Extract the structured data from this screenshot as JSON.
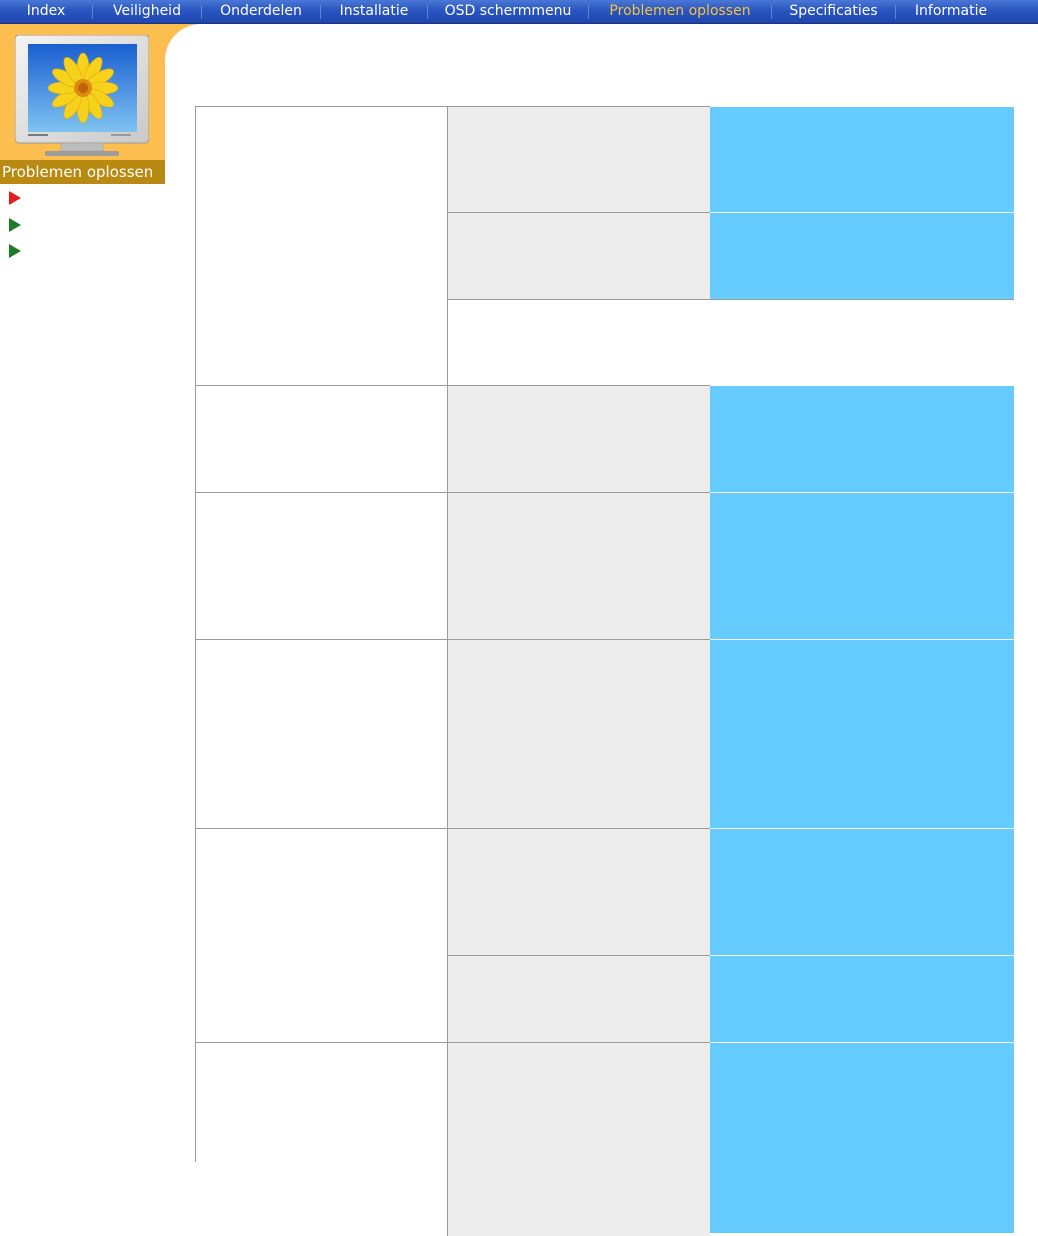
{
  "nav": {
    "items": [
      {
        "label": "Index",
        "active": false
      },
      {
        "label": "Veiligheid",
        "active": false
      },
      {
        "label": "Onderdelen",
        "active": false
      },
      {
        "label": "Installatie",
        "active": false
      },
      {
        "label": "OSD schermmenu",
        "active": false
      },
      {
        "label": "Problemen oplossen",
        "active": true
      },
      {
        "label": "Specificaties",
        "active": false
      },
      {
        "label": "Informatie",
        "active": false
      }
    ]
  },
  "sidebar": {
    "section_label": "Problemen oplossen",
    "links": [
      {
        "icon": "red-arrow-icon",
        "active": true
      },
      {
        "icon": "green-arrow-icon",
        "active": false
      },
      {
        "icon": "green-arrow-icon",
        "active": false
      }
    ]
  },
  "colors": {
    "nav_bg": "#2a55c0",
    "nav_active_text": "#f5c53a",
    "panel_bg": "#fcbf4f",
    "label_bg": "#b98a12",
    "cell_grey": "#ededed",
    "cell_blue": "#66ccff"
  }
}
